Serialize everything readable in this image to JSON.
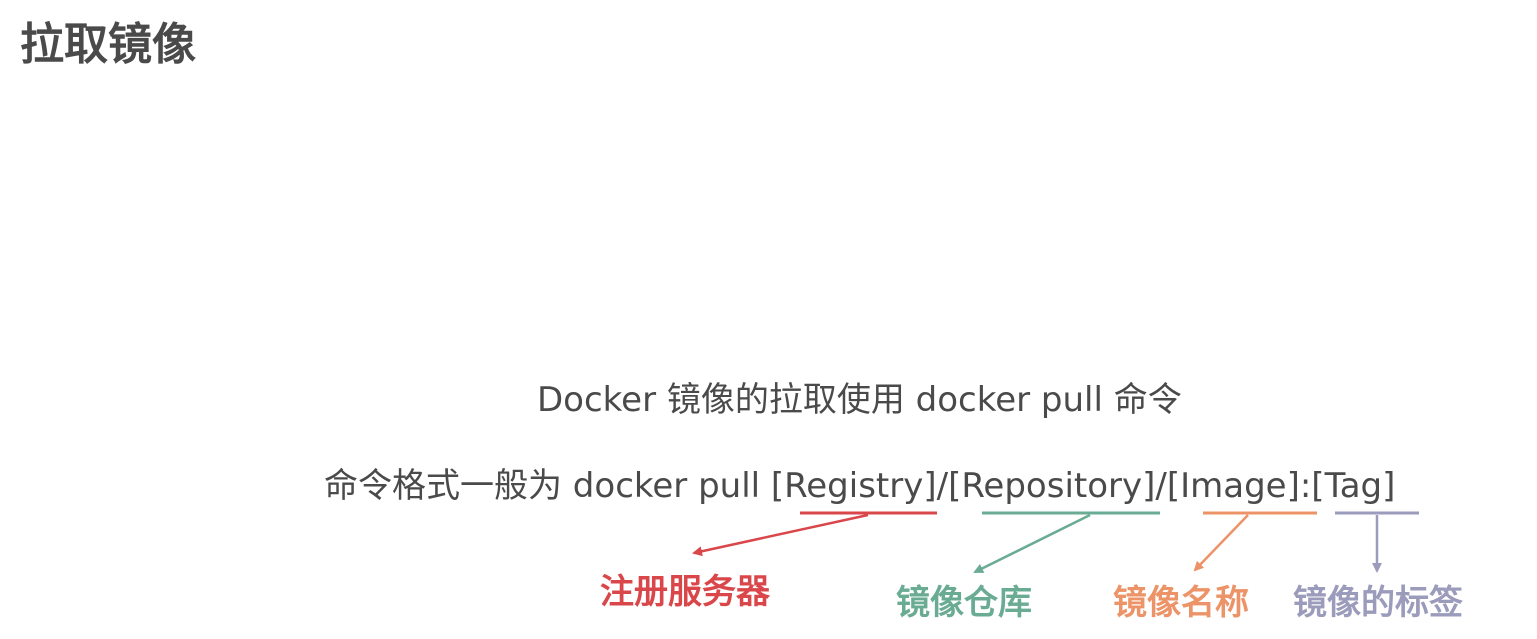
{
  "title": "拉取镜像",
  "description": {
    "line1": "Docker 镜像的拉取使用 docker pull 命令",
    "line2": "命令格式一般为 docker pull [Registry]/[Repository]/[Image]:[Tag]"
  },
  "annotations": [
    {
      "id": "registry",
      "label": "注册服务器",
      "color": "#d9474b"
    },
    {
      "id": "repository",
      "label": "镜像仓库",
      "color": "#6aab94"
    },
    {
      "id": "image",
      "label": "镜像名称",
      "color": "#ec9367"
    },
    {
      "id": "tag",
      "label": "镜像的标签",
      "color": "#9b9bbb"
    }
  ]
}
